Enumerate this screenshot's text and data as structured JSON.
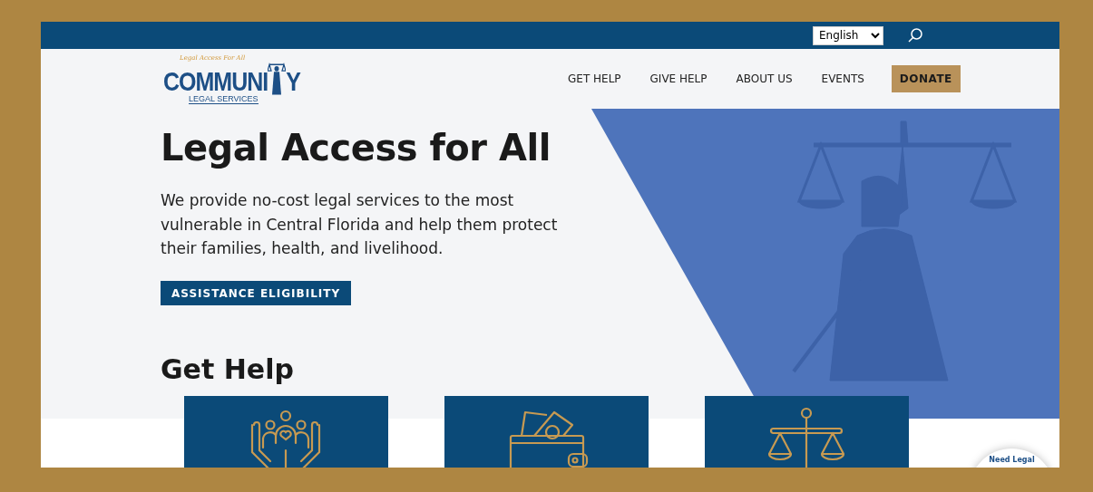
{
  "top_bar": {
    "language": "English"
  },
  "logo": {
    "tagline": "Legal Access For All",
    "wordmark_start": "COMMUNI",
    "wordmark_end": "Y",
    "subtitle": "LEGAL SERVICES"
  },
  "nav": {
    "items": [
      "GET HELP",
      "GIVE HELP",
      "ABOUT US",
      "EVENTS"
    ],
    "donate": "DONATE"
  },
  "hero": {
    "title": "Legal Access for All",
    "text": "We provide no-cost legal services to the most vulnerable in Central Florida and help them protect their families, health, and livelihood.",
    "button": "ASSISTANCE ELIGIBILITY"
  },
  "section": {
    "title": "Get Help",
    "cards": [
      {
        "kind": "family"
      },
      {
        "kind": "wallet"
      },
      {
        "kind": "scales"
      }
    ]
  },
  "chat_badge": {
    "text": "Need Legal"
  }
}
